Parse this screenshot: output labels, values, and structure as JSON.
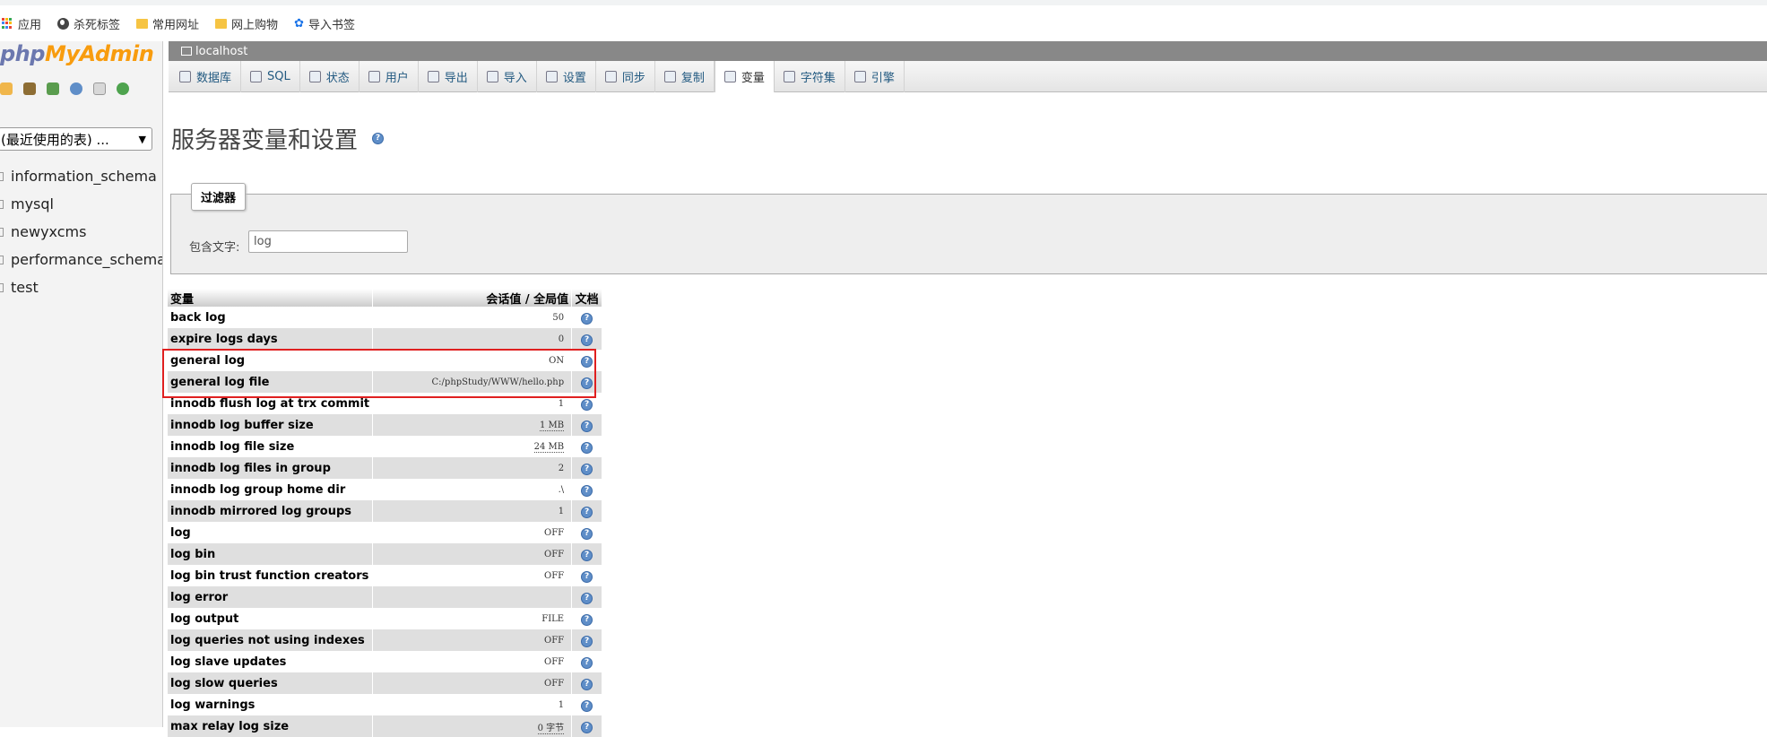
{
  "bookmarks": [
    {
      "label": "应用",
      "icon": "apps-icon"
    },
    {
      "label": "杀死标签",
      "icon": "globe-icon"
    },
    {
      "label": "常用网址",
      "icon": "folder-icon"
    },
    {
      "label": "网上购物",
      "icon": "folder-icon"
    },
    {
      "label": "导入书签",
      "icon": "gear-icon"
    }
  ],
  "nav": {
    "logo_php": "php",
    "logo_myadmin": "MyAdmin",
    "recent_select": "(最近使用的表) ...",
    "databases": [
      "information_schema",
      "mysql",
      "newyxcms",
      "performance_schema",
      "test"
    ]
  },
  "server": {
    "name": "localhost"
  },
  "tabs": [
    {
      "label": "数据库",
      "active": false
    },
    {
      "label": "SQL",
      "active": false
    },
    {
      "label": "状态",
      "active": false
    },
    {
      "label": "用户",
      "active": false
    },
    {
      "label": "导出",
      "active": false
    },
    {
      "label": "导入",
      "active": false
    },
    {
      "label": "设置",
      "active": false
    },
    {
      "label": "同步",
      "active": false
    },
    {
      "label": "复制",
      "active": false
    },
    {
      "label": "变量",
      "active": true
    },
    {
      "label": "字符集",
      "active": false
    },
    {
      "label": "引擎",
      "active": false
    }
  ],
  "page": {
    "title": "服务器变量和设置"
  },
  "filter": {
    "legend": "过滤器",
    "label": "包含文字:",
    "value": "log"
  },
  "table": {
    "headers": [
      "变量",
      "会话值 / 全局值",
      "文档"
    ],
    "rows": [
      {
        "name": "back log",
        "value": "50"
      },
      {
        "name": "expire logs days",
        "value": "0"
      },
      {
        "name": "general log",
        "value": "ON"
      },
      {
        "name": "general log file",
        "value": "C:/phpStudy/WWW/hello.php"
      },
      {
        "name": "innodb flush log at trx commit",
        "value": "1"
      },
      {
        "name": "innodb log buffer size",
        "value": "1 MB"
      },
      {
        "name": "innodb log file size",
        "value": "24 MB"
      },
      {
        "name": "innodb log files in group",
        "value": "2"
      },
      {
        "name": "innodb log group home dir",
        "value": ".\\"
      },
      {
        "name": "innodb mirrored log groups",
        "value": "1"
      },
      {
        "name": "log",
        "value": "OFF"
      },
      {
        "name": "log bin",
        "value": "OFF"
      },
      {
        "name": "log bin trust function creators",
        "value": "OFF"
      },
      {
        "name": "log error",
        "value": ""
      },
      {
        "name": "log output",
        "value": "FILE"
      },
      {
        "name": "log queries not using indexes",
        "value": "OFF"
      },
      {
        "name": "log slave updates",
        "value": "OFF"
      },
      {
        "name": "log slow queries",
        "value": "OFF"
      },
      {
        "name": "log warnings",
        "value": "1"
      },
      {
        "name": "max relay log size",
        "value": "0 字节"
      }
    ]
  },
  "colors": {
    "highlight": "#e02020",
    "logo_php": "#6c78af",
    "logo_myadmin": "#f89c0e",
    "link": "#235a81"
  }
}
